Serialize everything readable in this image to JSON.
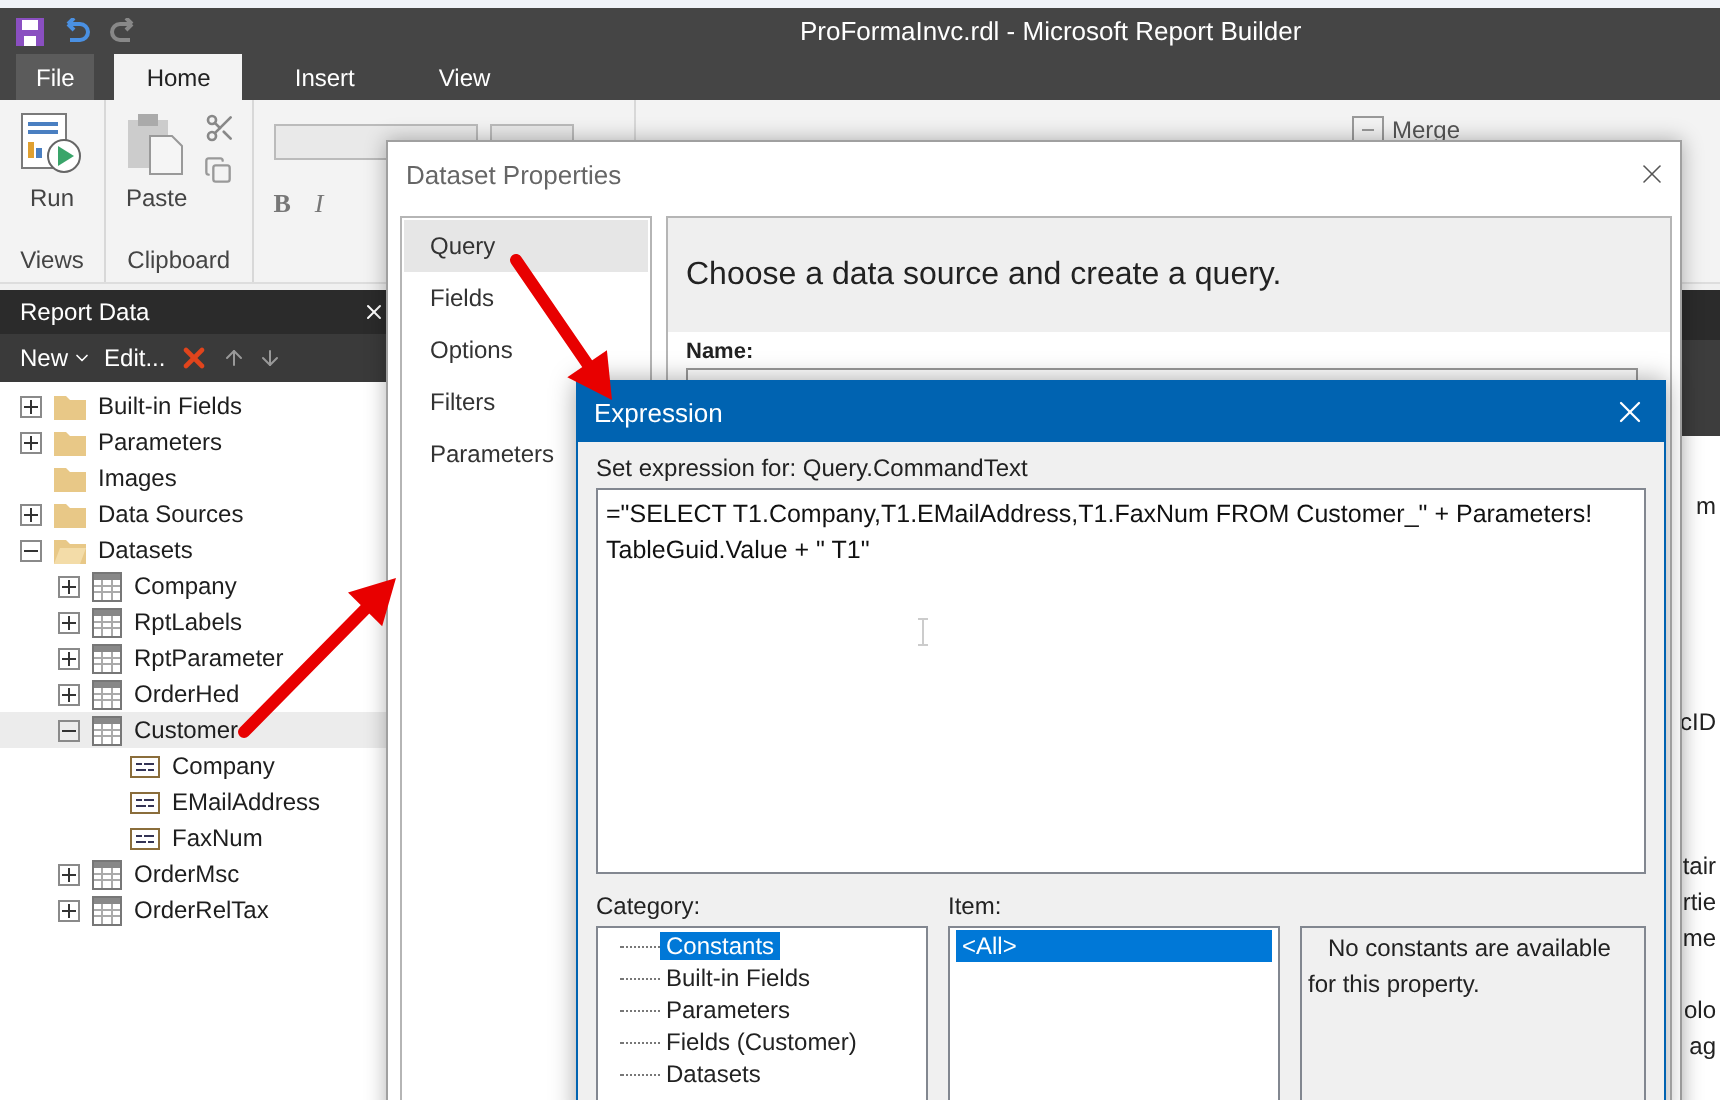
{
  "window": {
    "title": "ProFormaInvc.rdl - Microsoft Report Builder"
  },
  "ribbon_tabs": [
    {
      "label": "File",
      "kind": "file",
      "selected": false
    },
    {
      "label": "Home",
      "kind": "tab",
      "selected": true
    },
    {
      "label": "Insert",
      "kind": "tab",
      "selected": false
    },
    {
      "label": "View",
      "kind": "tab",
      "selected": false
    }
  ],
  "ribbon_groups": [
    {
      "label": "Views",
      "kind": "views",
      "button": "Run"
    },
    {
      "label": "Clipboard",
      "kind": "clipboard",
      "button": "Paste"
    }
  ],
  "ribbon_format_buttons": [
    "B",
    "I"
  ],
  "ribbon_merge": "Merge",
  "report_data": {
    "title": "Report Data",
    "new_button": "New",
    "edit_button": "Edit...",
    "tree": [
      {
        "label": "Built-in Fields",
        "kind": "folder",
        "has_children": true,
        "expanded": false,
        "selected": false
      },
      {
        "label": "Parameters",
        "kind": "folder",
        "has_children": true,
        "expanded": false,
        "selected": false
      },
      {
        "label": "Images",
        "kind": "folder",
        "has_children": false,
        "selected": false
      },
      {
        "label": "Data Sources",
        "kind": "folder",
        "has_children": true,
        "expanded": false,
        "selected": false
      },
      {
        "label": "Datasets",
        "kind": "open-folder",
        "has_children": true,
        "expanded": true,
        "selected": false,
        "children": [
          {
            "label": "Company",
            "kind": "dataset",
            "has_children": true,
            "expanded": false,
            "selected": false
          },
          {
            "label": "RptLabels",
            "kind": "dataset",
            "has_children": true,
            "expanded": false,
            "selected": false
          },
          {
            "label": "RptParameter",
            "kind": "dataset",
            "has_children": true,
            "expanded": false,
            "selected": false
          },
          {
            "label": "OrderHed",
            "kind": "dataset",
            "has_children": true,
            "expanded": false,
            "selected": false
          },
          {
            "label": "Customer",
            "kind": "dataset",
            "has_children": true,
            "expanded": true,
            "selected": true,
            "children": [
              {
                "label": "Company",
                "kind": "field",
                "has_children": false,
                "selected": false
              },
              {
                "label": "EMailAddress",
                "kind": "field",
                "has_children": false,
                "selected": false
              },
              {
                "label": "FaxNum",
                "kind": "field",
                "has_children": false,
                "selected": false
              }
            ]
          },
          {
            "label": "OrderMsc",
            "kind": "dataset",
            "has_children": true,
            "expanded": false,
            "selected": false
          },
          {
            "label": "OrderRelTax",
            "kind": "dataset",
            "has_children": true,
            "expanded": false,
            "selected": false
          }
        ]
      }
    ]
  },
  "background_fragments": [
    "m",
    "cID",
    "tair",
    "rtie",
    "me",
    "olo",
    "ag"
  ],
  "dataset_dialog": {
    "title": "Dataset Properties",
    "nav": [
      {
        "label": "Query",
        "selected": true
      },
      {
        "label": "Fields",
        "selected": false
      },
      {
        "label": "Options",
        "selected": false
      },
      {
        "label": "Filters",
        "selected": false
      },
      {
        "label": "Parameters",
        "selected": false
      }
    ],
    "heading": "Choose a data source and create a query.",
    "name_label": "Name:"
  },
  "expression_dialog": {
    "title": "Expression",
    "prompt": "Set expression for: Query.CommandText",
    "expression_lines": [
      "=\"SELECT T1.Company,T1.EMailAddress,T1.FaxNum FROM Customer_\" + Parameters!",
      "TableGuid.Value + \" T1\""
    ],
    "category_label": "Category:",
    "categories": [
      {
        "label": "Constants",
        "selected": true
      },
      {
        "label": "Built-in Fields",
        "selected": false
      },
      {
        "label": "Parameters",
        "selected": false
      },
      {
        "label": "Fields (Customer)",
        "selected": false
      },
      {
        "label": "Datasets",
        "selected": false
      }
    ],
    "item_label": "Item:",
    "items": [
      {
        "label": "<All>",
        "selected": true
      }
    ],
    "description": "No constants are available for this property."
  }
}
